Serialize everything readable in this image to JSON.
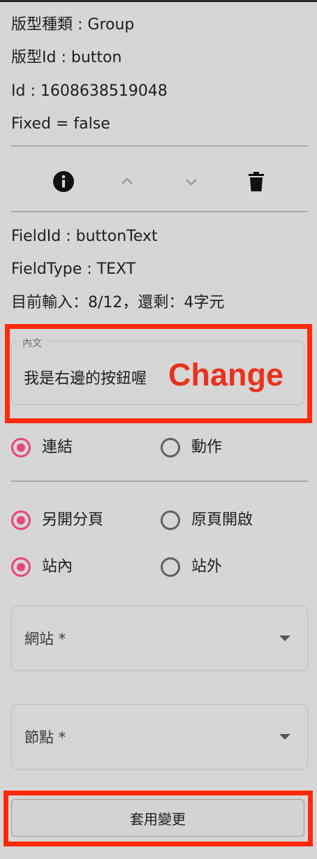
{
  "meta": {
    "template_type": "版型種類 : Group",
    "template_id": "版型Id : button",
    "id": "Id : 1608638519048",
    "fixed": "Fixed = false"
  },
  "toolbar": {
    "icons": [
      "info-icon",
      "chevron-up-icon",
      "chevron-down-icon",
      "trash-icon"
    ]
  },
  "field": {
    "field_id": "FieldId : buttonText",
    "field_type": "FieldType : TEXT",
    "input_count": "目前輸入：8/12，還剩：4字元"
  },
  "content_box": {
    "label": "內文",
    "value": "我是右邊的按鈕喔"
  },
  "annotation": {
    "change_text": "Change",
    "highlight_color": "#ff2a0b"
  },
  "radio_groups": {
    "type": {
      "options": [
        "連結",
        "動作"
      ],
      "selected": "連結"
    },
    "open_mode": {
      "options": [
        "另開分頁",
        "原頁開啟"
      ],
      "selected": "另開分頁"
    },
    "site_scope": {
      "options": [
        "站內",
        "站外"
      ],
      "selected": "站內"
    }
  },
  "selects": {
    "website": {
      "label": "網站 *"
    },
    "node": {
      "label": "節點 *"
    }
  },
  "apply_button": {
    "label": "套用變更"
  },
  "colors": {
    "accent": "#e8457a",
    "background": "#d6d6d6"
  }
}
